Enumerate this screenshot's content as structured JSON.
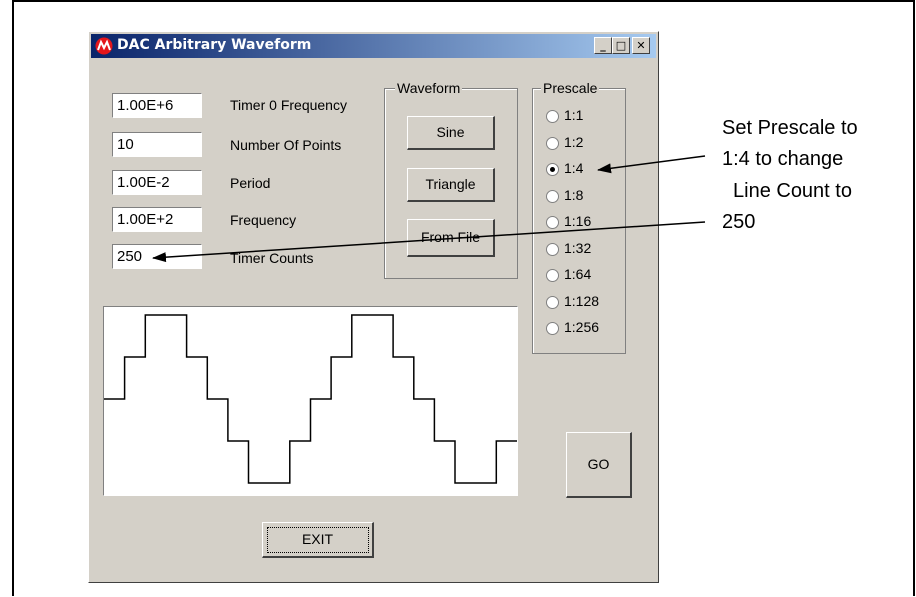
{
  "window": {
    "title": "DAC Arbitrary Waveform",
    "minimize": "_",
    "maximize": "□",
    "close": "✕"
  },
  "fields": [
    {
      "value": "1.00E+6",
      "label": "Timer 0 Frequency"
    },
    {
      "value": "10",
      "label": "Number Of Points"
    },
    {
      "value": "1.00E-2",
      "label": "Period"
    },
    {
      "value": "1.00E+2",
      "label": "Frequency"
    },
    {
      "value": "250",
      "label": "Timer Counts"
    }
  ],
  "waveform": {
    "legend": "Waveform",
    "buttons": [
      "Sine",
      "Triangle",
      "From File"
    ]
  },
  "prescale": {
    "legend": "Prescale",
    "options": [
      "1:1",
      "1:2",
      "1:4",
      "1:8",
      "1:16",
      "1:32",
      "1:64",
      "1:128",
      "1:256"
    ],
    "selected": "1:4"
  },
  "plot_levels": [
    0,
    1,
    2,
    2,
    1,
    0,
    -1,
    -2,
    -2,
    -1,
    0,
    1,
    2,
    2,
    1,
    0,
    -1,
    -2,
    -2,
    -1
  ],
  "go_label": "GO",
  "exit_label": "EXIT",
  "annotation": {
    "lines": [
      "Set Prescale to",
      "1:4 to change",
      "Line Count to",
      "250"
    ]
  },
  "colors": {
    "title_start": "#0a246a",
    "title_end": "#a6caf0",
    "face": "#d4d0c8"
  },
  "icons": {
    "app": "microchip-logo-icon"
  }
}
